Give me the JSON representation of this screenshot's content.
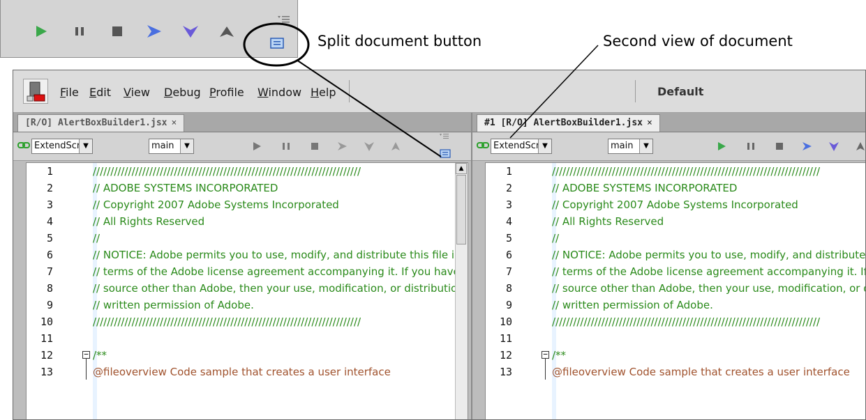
{
  "callouts": {
    "split_button": "Split document button",
    "second_view": "Second view of document"
  },
  "app": {
    "menu": [
      "File",
      "Edit",
      "View",
      "Debug",
      "Profile",
      "Window",
      "Help"
    ],
    "menu_mnemonics": [
      "F",
      "E",
      "V",
      "D",
      "P",
      "W",
      "H"
    ],
    "workspace": "Default"
  },
  "left_panel": {
    "tab_label": "[R/O] AlertBoxBuilder1.jsx",
    "tab_close": "×",
    "target_select": "ExtendScr",
    "function_select": "main"
  },
  "right_panel": {
    "tab_label": "#1 [R/O] AlertBoxBuilder1.jsx",
    "tab_close": "×",
    "target_select": "ExtendScr",
    "function_select": "main"
  },
  "code_lines": [
    {
      "n": "1",
      "text": "////////////////////////////////////////////////////////////////////////////",
      "kind": "comment"
    },
    {
      "n": "2",
      "text": "// ADOBE SYSTEMS INCORPORATED",
      "kind": "comment"
    },
    {
      "n": "3",
      "text": "// Copyright 2007 Adobe Systems Incorporated",
      "kind": "comment"
    },
    {
      "n": "4",
      "text": "// All Rights Reserved",
      "kind": "comment"
    },
    {
      "n": "5",
      "text": "//",
      "kind": "comment"
    },
    {
      "n": "6",
      "text": "// NOTICE:  Adobe permits you to use, modify, and distribute this file in accordance with the",
      "kind": "comment"
    },
    {
      "n": "7",
      "text": "// terms of the Adobe license agreement accompanying it.  If you have received this file from a",
      "kind": "comment"
    },
    {
      "n": "8",
      "text": "// source other than Adobe, then your use, modification, or distribution of it requires the prior",
      "kind": "comment"
    },
    {
      "n": "9",
      "text": "// written permission of Adobe.",
      "kind": "comment"
    },
    {
      "n": "10",
      "text": "////////////////////////////////////////////////////////////////////////////",
      "kind": "comment"
    },
    {
      "n": "11",
      "text": "",
      "kind": "comment"
    },
    {
      "n": "12",
      "text": "/**",
      "kind": "comment"
    },
    {
      "n": "13",
      "text": "@fileoverview Code sample that creates a user interface",
      "kind": "doc"
    }
  ],
  "colors": {
    "comment": "#2a8a1a",
    "doctag": "#a0522d",
    "run": "#3aa84a",
    "step": "#4a6fe0",
    "stop": "#555555"
  },
  "icons": [
    "run-icon",
    "pause-icon",
    "stop-icon",
    "step-over-icon",
    "step-into-icon",
    "step-out-icon",
    "split-document-icon",
    "link-icon",
    "app-logo-icon"
  ]
}
